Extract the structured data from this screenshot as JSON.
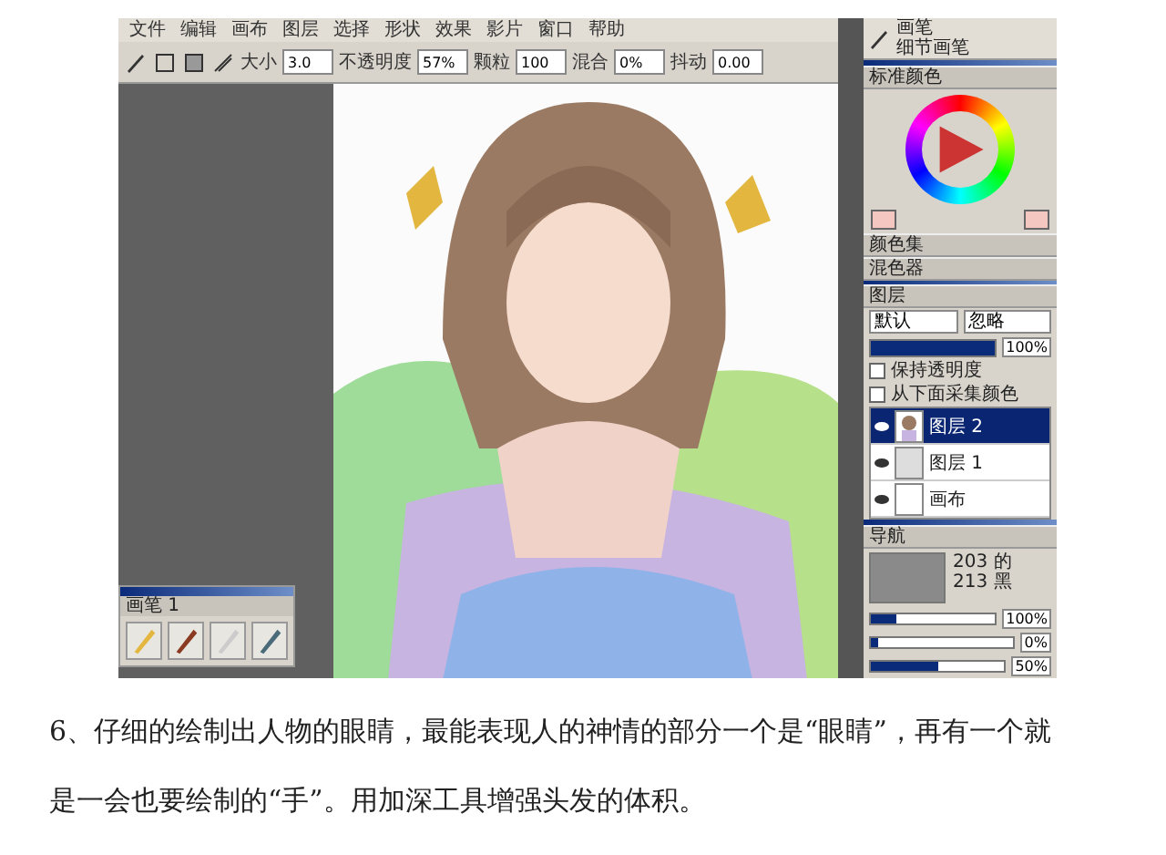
{
  "menu": [
    {
      "label": "文件"
    },
    {
      "label": "编辑"
    },
    {
      "label": "画布"
    },
    {
      "label": "图层"
    },
    {
      "label": "选择"
    },
    {
      "label": "形状"
    },
    {
      "label": "效果"
    },
    {
      "label": "影片"
    },
    {
      "label": "窗口"
    },
    {
      "label": "帮助"
    }
  ],
  "toolbar": {
    "fields": [
      {
        "label": "大小",
        "value": "3.0"
      },
      {
        "label": "不透明度",
        "value": "57%"
      },
      {
        "label": "颗粒",
        "value": "100"
      },
      {
        "label": "混合",
        "value": "0%"
      },
      {
        "label": "抖动",
        "value": "0.00"
      }
    ]
  },
  "brush_selector": {
    "category": "画笔",
    "variant": "细节画笔"
  },
  "color_panel": {
    "title": "标准颜色"
  },
  "collapsed_panels": [
    {
      "title": "颜色集"
    },
    {
      "title": "混色器"
    }
  ],
  "layers_panel": {
    "title": "图层",
    "composite_method": "默认",
    "composite_depth": "忽略",
    "opacity": "100%",
    "opacity_slider": {
      "level": 1
    },
    "options": [
      {
        "label": "保持透明度",
        "checked": false
      },
      {
        "label": "从下面采集颜色",
        "checked": false
      }
    ],
    "layers": [
      {
        "name": "图层 2",
        "kind": "painting",
        "selected": true
      },
      {
        "name": "图层 1",
        "kind": "empty",
        "selected": false
      },
      {
        "name": "画布",
        "kind": "canvas",
        "selected": false
      }
    ]
  },
  "navigator_panel": {
    "title": "导航",
    "size_lines": [
      "203 的",
      "213 黑"
    ],
    "sliders": [
      {
        "level": 0.2,
        "reading": "100%"
      },
      {
        "level": 0.05,
        "reading": "0%"
      },
      {
        "level": 0.5,
        "reading": "50%"
      }
    ]
  },
  "brush_panel": {
    "title": "画笔 1"
  },
  "caption_lines": [
    "6、仔细的绘制出人物的眼睛，最能表现人的神情的部分一个是“眼睛”，再有一个就",
    "是一会也要绘制的“手”。用加深工具增强头发的体积。"
  ]
}
